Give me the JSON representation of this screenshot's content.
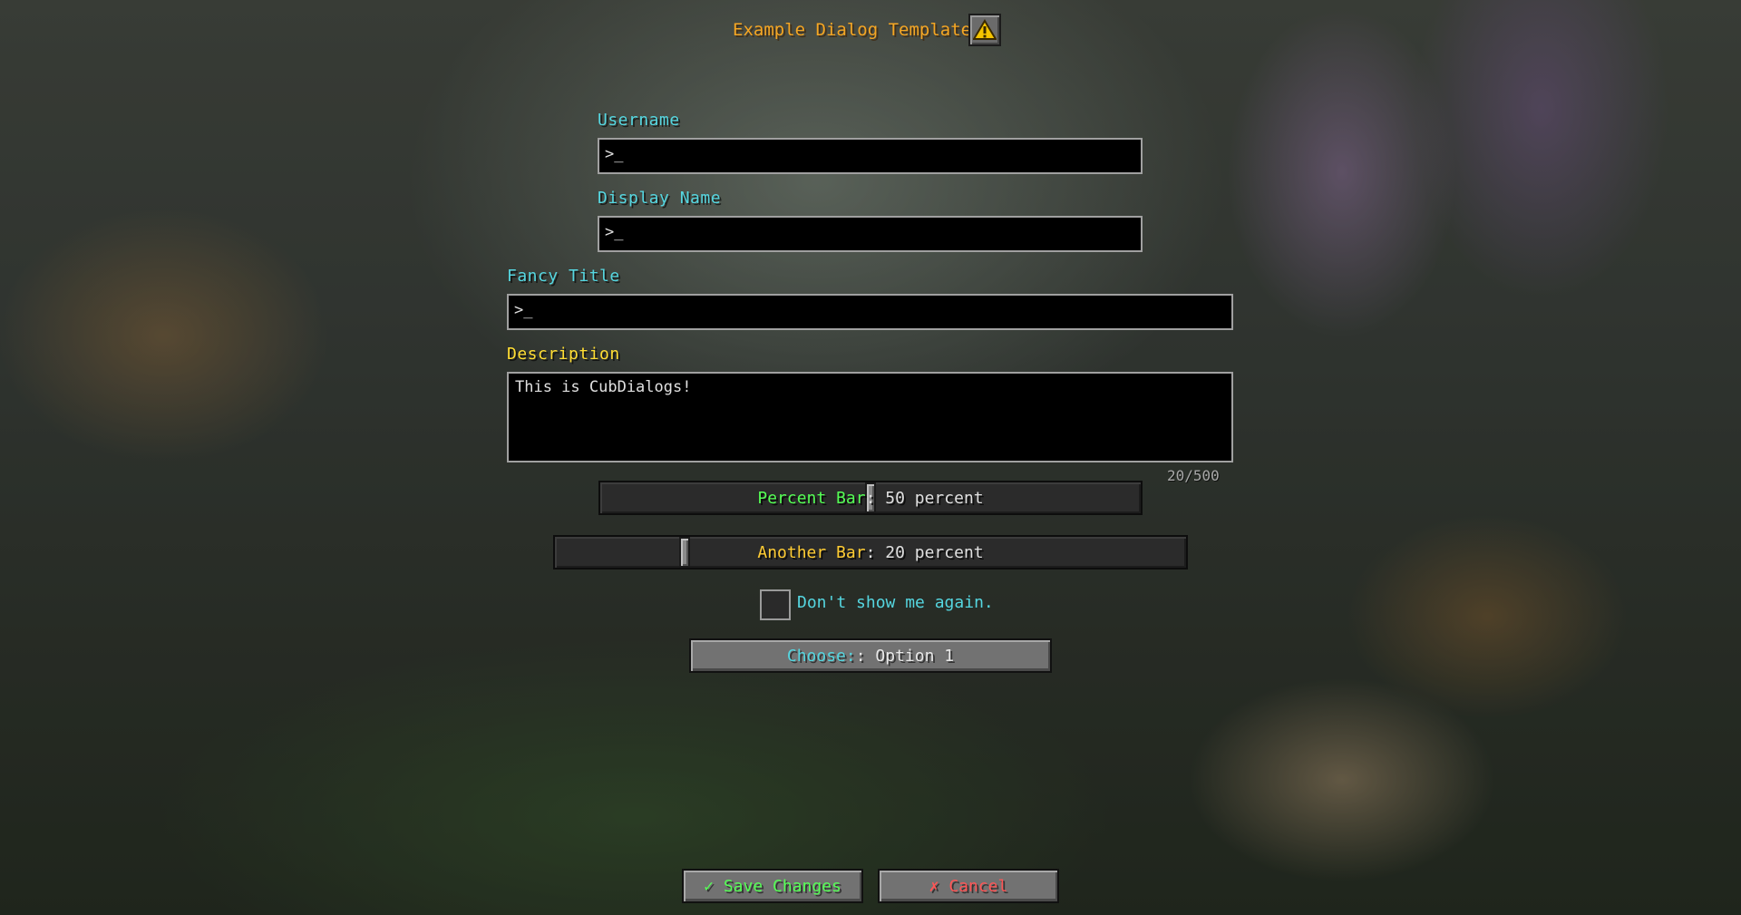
{
  "dialog": {
    "title": "Example Dialog Template",
    "warning_icon": "warning-triangle-icon"
  },
  "fields": {
    "username": {
      "label": "Username",
      "value": ">_"
    },
    "display_name": {
      "label": "Display Name",
      "value": ">_"
    },
    "fancy_title": {
      "label": "Fancy Title",
      "value": ">_"
    },
    "description": {
      "label": "Description",
      "value": "This is CubDialogs!",
      "counter": "20/500"
    }
  },
  "sliders": {
    "percent_bar": {
      "name": "Percent Bar",
      "value_text": ": 50 percent",
      "value_percent": 50
    },
    "another_bar": {
      "name": "Another Bar",
      "value_text": ": 20 percent",
      "value_percent": 20
    }
  },
  "checkbox": {
    "label": "Don't show me again.",
    "checked": false
  },
  "select": {
    "key": "Choose:",
    "value": " : Option 1"
  },
  "actions": {
    "save_label": "✓ Save Changes",
    "cancel_label": "✗ Cancel"
  },
  "colors": {
    "title": "#f5a623",
    "cyan_label": "#55d6e0",
    "yellow_label": "#ffdd33",
    "green": "#55ff55",
    "red": "#ff5555"
  }
}
